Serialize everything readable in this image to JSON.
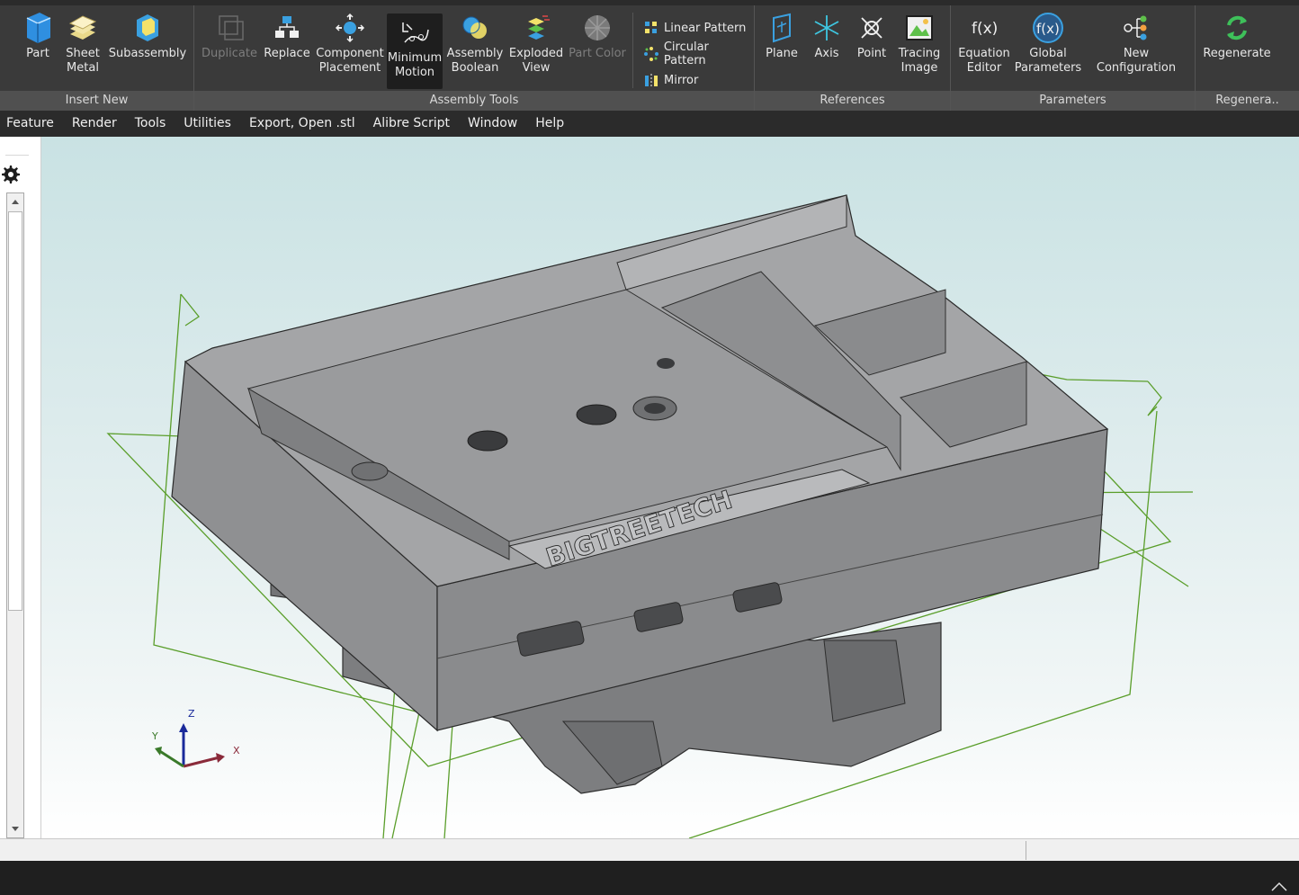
{
  "ribbon": {
    "groups": [
      {
        "label": "Insert New"
      },
      {
        "label": "Assembly Tools"
      },
      {
        "label": "References"
      },
      {
        "label": "Parameters"
      },
      {
        "label": "Regenera.."
      }
    ],
    "insert_new": {
      "part": {
        "line1": "Part",
        "line2": "",
        "icon": "part-icon"
      },
      "sheet_metal": {
        "line1": "Sheet",
        "line2": "Metal",
        "icon": "sheet-metal-icon"
      },
      "subassembly": {
        "line1": "Subassembly",
        "line2": "",
        "icon": "subassembly-icon"
      }
    },
    "assembly_tools": {
      "duplicate": {
        "line1": "Duplicate",
        "line2": ""
      },
      "replace": {
        "line1": "Replace",
        "line2": ""
      },
      "component_placement": {
        "line1": "Component",
        "line2": "Placement"
      },
      "minimum_motion": {
        "line1": "Minimum",
        "line2": "Motion"
      },
      "assembly_boolean": {
        "line1": "Assembly",
        "line2": "Boolean"
      },
      "exploded_view": {
        "line1": "Exploded",
        "line2": "View"
      },
      "part_color": {
        "line1": "Part Color",
        "line2": ""
      },
      "linear_pattern": "Linear Pattern",
      "circular_pattern": "Circular Pattern",
      "mirror": "Mirror"
    },
    "references": {
      "plane": {
        "line1": "Plane",
        "line2": ""
      },
      "axis": {
        "line1": "Axis",
        "line2": ""
      },
      "point": {
        "line1": "Point",
        "line2": ""
      },
      "tracing_image": {
        "line1": "Tracing",
        "line2": "Image"
      }
    },
    "parameters": {
      "equation_editor": {
        "line1": "Equation",
        "line2": "Editor"
      },
      "global_parameters": {
        "line1": "Global",
        "line2": "Parameters"
      },
      "new_configuration": {
        "line1": "New Configuration",
        "line2": ""
      }
    },
    "regenerate": {
      "line1": "Regenerate",
      "line2": ""
    }
  },
  "menu": [
    "Feature",
    "Render",
    "Tools",
    "Utilities",
    "Export, Open .stl",
    "Alibre Script",
    "Window",
    "Help"
  ],
  "viewport": {
    "model_text": "BIGTREETECH",
    "triad": {
      "x": "X",
      "y": "Y",
      "z": "Z"
    }
  },
  "colors": {
    "ribbon_bg": "#3a3a3a",
    "accent_blue": "#3aa0e0",
    "model_gray": "#8d8e90",
    "reference_green": "#5a9e2a"
  }
}
